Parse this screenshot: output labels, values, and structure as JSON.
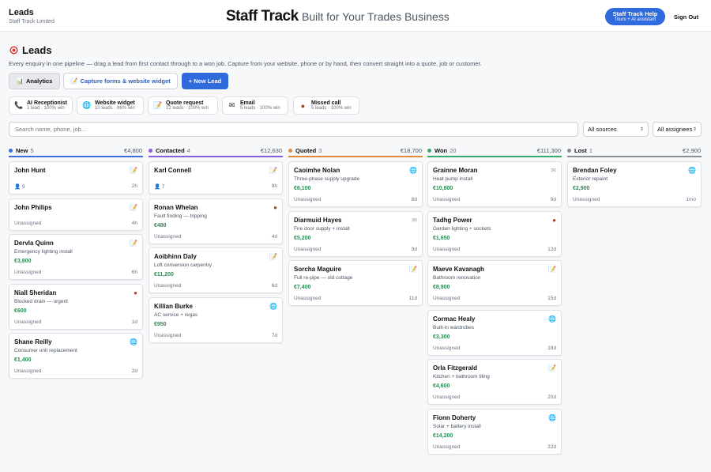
{
  "header": {
    "org_title": "Leads",
    "org_sub": "Staff Track Limited",
    "app_name": "Staff Track",
    "app_tagline": "Built for Your Trades Business",
    "help_title": "Staff Track Help",
    "help_sub": "Tours + AI assistant",
    "signout": "Sign Out"
  },
  "page": {
    "title": "Leads",
    "description": "Every enquiry in one pipeline — drag a lead from first contact through to a won job. Capture from your website, phone or by hand, then convert straight into a quote, job or customer."
  },
  "actions": {
    "analytics": "Analytics",
    "capture": "Capture forms & website widget",
    "new_lead": "+ New Lead"
  },
  "sources": [
    {
      "icon": "📞",
      "name": "AI Receptionist",
      "stats": "1 lead · 100% win"
    },
    {
      "icon": "🌐",
      "name": "Website widget",
      "stats": "10 leads · 86% win"
    },
    {
      "icon": "📝",
      "name": "Quote request",
      "stats": "12 leads · 100% win"
    },
    {
      "icon": "✉",
      "name": "Email",
      "stats": "5 leads · 100% win"
    },
    {
      "icon": "●",
      "name": "Missed call",
      "stats": "5 leads · 100% win"
    }
  ],
  "filters": {
    "search_placeholder": "Search name, phone, job...",
    "sources_value": "All sources",
    "assignees_value": "All assignees"
  },
  "columns": [
    {
      "name": "New",
      "count": "5",
      "sum": "€4,800",
      "color": "#3b6fd8",
      "cards": [
        {
          "name": "John Hunt",
          "icon": "📝",
          "assignee": "👤 9",
          "age": "2h"
        },
        {
          "name": "John Philips",
          "icon": "📝",
          "assignee": "Unassigned",
          "age": "4h"
        },
        {
          "name": "Dervla Quinn",
          "icon": "📝",
          "desc": "Emergency lighting install",
          "value": "€3,800",
          "assignee": "Unassigned",
          "age": "6h"
        },
        {
          "name": "Niall Sheridan",
          "icon": "●",
          "desc": "Blocked drain — urgent",
          "value": "€600",
          "assignee": "Unassigned",
          "age": "1d"
        },
        {
          "name": "Shane Reilly",
          "icon": "🌐",
          "desc": "Consumer unit replacement",
          "value": "€1,400",
          "assignee": "Unassigned",
          "age": "2d"
        }
      ]
    },
    {
      "name": "Contacted",
      "count": "4",
      "sum": "€12,630",
      "color": "#8a5cd6",
      "cards": [
        {
          "name": "Karl Connell",
          "icon": "📝",
          "assignee": "👤 7",
          "age": "9h"
        },
        {
          "name": "Ronan Whelan",
          "icon": "●",
          "desc": "Fault finding — tripping",
          "value": "€480",
          "assignee": "Unassigned",
          "age": "4d"
        },
        {
          "name": "Aoibhinn Daly",
          "icon": "📝",
          "desc": "Loft conversion carpentry",
          "value": "€11,200",
          "assignee": "Unassigned",
          "age": "6d"
        },
        {
          "name": "Killian Burke",
          "icon": "🌐",
          "desc": "AC service + regas",
          "value": "€950",
          "assignee": "Unassigned",
          "age": "7d"
        }
      ]
    },
    {
      "name": "Quoted",
      "count": "3",
      "sum": "€18,700",
      "color": "#e08a3c",
      "cards": [
        {
          "name": "Caoimhe Nolan",
          "icon": "🌐",
          "desc": "Three-phase supply upgrade",
          "value": "€6,100",
          "assignee": "Unassigned",
          "age": "8d"
        },
        {
          "name": "Diarmuid Hayes",
          "icon": "✉",
          "desc": "Fire door supply + install",
          "value": "€5,200",
          "assignee": "Unassigned",
          "age": "9d"
        },
        {
          "name": "Sorcha Maguire",
          "icon": "📝",
          "desc": "Full re-pipe — old cottage",
          "value": "€7,400",
          "assignee": "Unassigned",
          "age": "11d"
        }
      ]
    },
    {
      "name": "Won",
      "count": "20",
      "sum": "€111,300",
      "color": "#3aa76d",
      "cards": [
        {
          "name": "Grainne Moran",
          "icon": "✉",
          "desc": "Heat pump install",
          "value": "€10,800",
          "assignee": "Unassigned",
          "age": "9d"
        },
        {
          "name": "Tadhg Power",
          "icon": "●",
          "desc": "Garden lighting + sockets",
          "value": "€1,650",
          "assignee": "Unassigned",
          "age": "12d"
        },
        {
          "name": "Maeve Kavanagh",
          "icon": "📝",
          "desc": "Bathroom renovation",
          "value": "€8,900",
          "assignee": "Unassigned",
          "age": "15d"
        },
        {
          "name": "Cormac Healy",
          "icon": "🌐",
          "desc": "Built-in wardrobes",
          "value": "€3,300",
          "assignee": "Unassigned",
          "age": "18d"
        },
        {
          "name": "Orla Fitzgerald",
          "icon": "📝",
          "desc": "Kitchen + bathroom tiling",
          "value": "€4,600",
          "assignee": "Unassigned",
          "age": "20d"
        },
        {
          "name": "Fionn Doherty",
          "icon": "🌐",
          "desc": "Solar + battery install",
          "value": "€14,200",
          "assignee": "Unassigned",
          "age": "22d"
        }
      ]
    },
    {
      "name": "Lost",
      "count": "1",
      "sum": "€2,900",
      "color": "#8a8f96",
      "cards": [
        {
          "name": "Brendan Foley",
          "icon": "🌐",
          "desc": "Exterior repaint",
          "value": "€2,900",
          "assignee": "Unassigned",
          "age": "1mo"
        }
      ]
    }
  ]
}
